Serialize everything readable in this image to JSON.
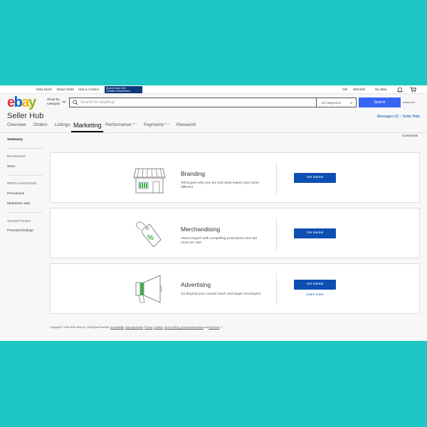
{
  "topbar": {
    "daily_deals": "Daily Deals",
    "brand_outlet": "Brand Outlet",
    "help_contact": "Help & Contact",
    "promo_line1": "Spend smart with",
    "promo_line2": "Certified Refurbished",
    "sell": "Sell",
    "watchlist": "Watchlist",
    "my_ebay": "My eBay",
    "bell_icon": "bell-icon",
    "cart_icon": "cart-icon"
  },
  "header": {
    "logo_letters": [
      "e",
      "b",
      "a",
      "y"
    ],
    "logo_colors": [
      "#e53238",
      "#0064d2",
      "#f5af02",
      "#86b817"
    ],
    "shop_by_line1": "Shop by",
    "shop_by_line2": "category",
    "search_placeholder": "Search for anything",
    "category": "All Categories",
    "search_button": "Search",
    "advanced": "Advanced"
  },
  "hub": {
    "title": "Seller Hub",
    "messages": "Messages (2)",
    "separator": "|",
    "seller_help": "Seller Help",
    "comments": "Comments"
  },
  "tabs": [
    {
      "label": "Overview",
      "beta": ""
    },
    {
      "label": "Orders",
      "beta": ""
    },
    {
      "label": "Listings",
      "beta": ""
    },
    {
      "label": "Marketing",
      "beta": ""
    },
    {
      "label": "Performance",
      "beta": "BETA"
    },
    {
      "label": "Payments",
      "beta": "BETA"
    },
    {
      "label": "Research",
      "beta": ""
    }
  ],
  "active_tab": "Marketing",
  "sidebar": {
    "summary": "Summary",
    "branding_header": "BRANDING",
    "store": "Store",
    "merch_header": "MERCHANDISING",
    "promotions": "Promotions",
    "markdown": "Markdown sale",
    "advertising_header": "ADVERTISING",
    "promoted": "Promoted listings"
  },
  "cards": [
    {
      "title": "Branding",
      "description": "Tell buyers who you are and what makes your Store different",
      "cta": "Get started",
      "link": "",
      "icon": "storefront-icon"
    },
    {
      "title": "Merchandising",
      "description": "Attract buyers with compelling promotions and sell more per visit",
      "cta": "Get started",
      "link": "",
      "icon": "price-tag-icon"
    },
    {
      "title": "Advertising",
      "description": "Go beyond your current reach and target new buyers",
      "cta": "Get started",
      "link": "Learn more",
      "icon": "megaphone-icon"
    }
  ],
  "footer": {
    "copyright": "Copyright © 1995-2020 eBay Inc. All Rights Reserved.",
    "accessibility": "Accessibility",
    "user_agreement": "User Agreement",
    "privacy": "Privacy",
    "cookies": "Cookies",
    "do_not_sell": "Do not sell my personal information",
    "and": "and",
    "adchoice": "AdChoice"
  },
  "colors": {
    "accent_green": "#3fb24a",
    "button_blue": "#0d4fb3",
    "search_blue": "#3665f3",
    "link_blue": "#0654ba"
  }
}
